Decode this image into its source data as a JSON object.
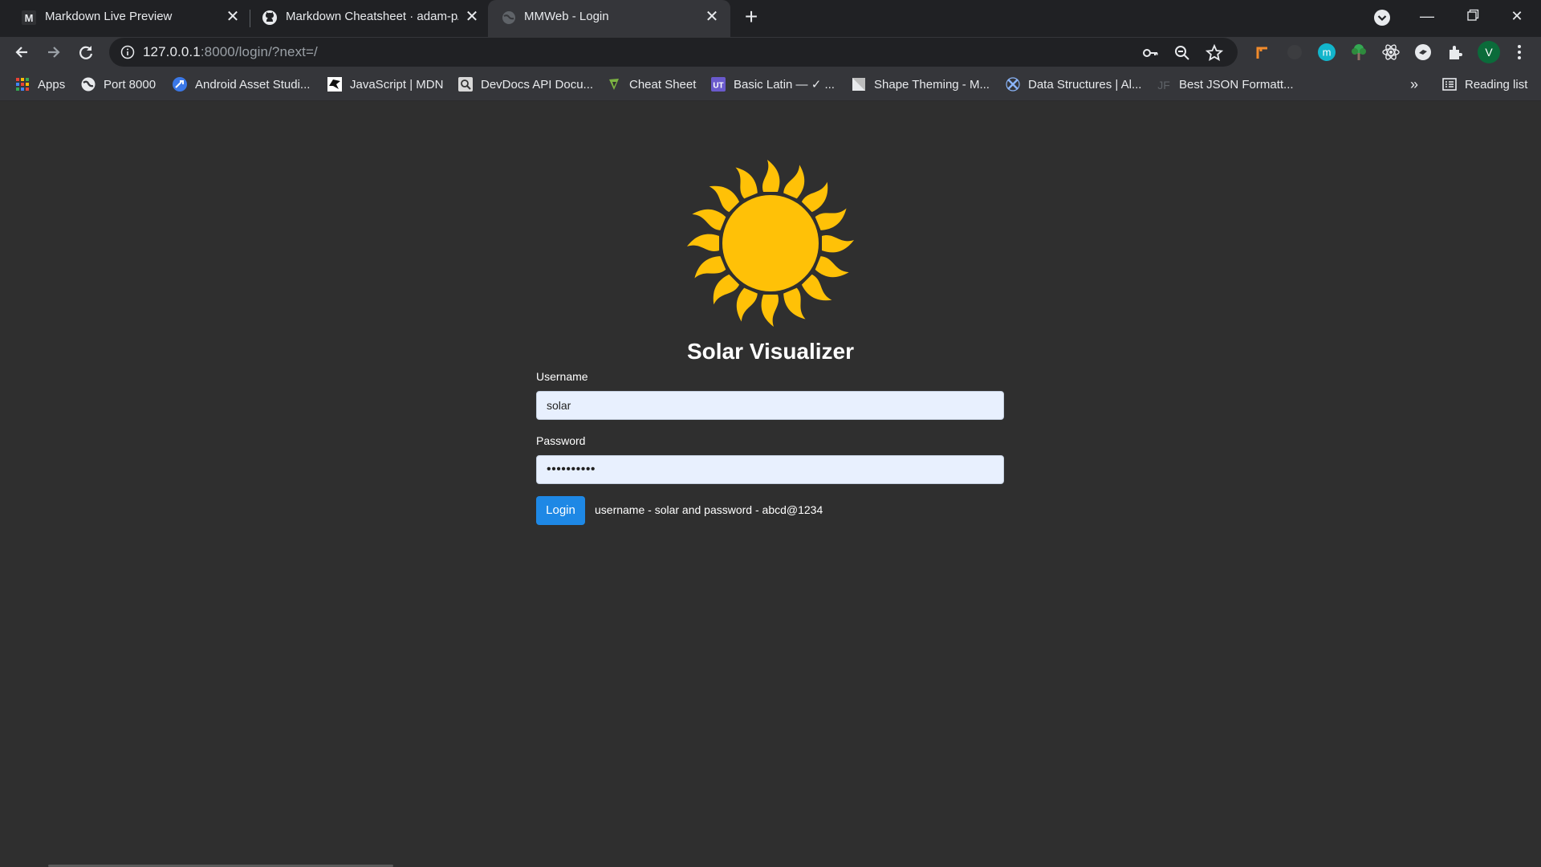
{
  "browser": {
    "tabs": [
      {
        "title": "Markdown Live Preview",
        "icon": "markdown-m-icon",
        "active": false
      },
      {
        "title": "Markdown Cheatsheet · adam-p/",
        "icon": "github-icon",
        "active": false
      },
      {
        "title": "MMWeb - Login",
        "icon": "globe-icon",
        "active": true
      }
    ],
    "address": {
      "host": "127.0.0.1",
      "rest": ":8000/login/?next=/"
    },
    "profile_initial": "V",
    "bookmarks": [
      {
        "label": "Apps",
        "icon": "apps-grid-icon"
      },
      {
        "label": "Port 8000",
        "icon": "globe-icon"
      },
      {
        "label": "Android Asset Studi...",
        "icon": "android-asset-icon"
      },
      {
        "label": "JavaScript | MDN",
        "icon": "mdn-icon"
      },
      {
        "label": "DevDocs API Docu...",
        "icon": "devdocs-icon"
      },
      {
        "label": "Cheat Sheet",
        "icon": "cheat-sheet-icon"
      },
      {
        "label": "Basic Latin — ✓ ...",
        "icon": "ut-icon"
      },
      {
        "label": "Shape Theming - M...",
        "icon": "material-icon"
      },
      {
        "label": "Data Structures | Al...",
        "icon": "data-structures-icon"
      },
      {
        "label": "Best JSON Formatt...",
        "icon": "jf-icon"
      }
    ],
    "bookmarks_overflow": "»",
    "reading_list": "Reading list"
  },
  "page": {
    "title": "Solar Visualizer",
    "username_label": "Username",
    "username_value": "solar",
    "password_label": "Password",
    "password_masked": "••••••••••",
    "login_label": "Login",
    "hint": "username - solar and password - abcd@1234"
  },
  "colors": {
    "page_bg": "#2f2f2f",
    "sun": "#ffc107",
    "button": "#1e88e5",
    "input_bg": "#e8f0fe"
  }
}
